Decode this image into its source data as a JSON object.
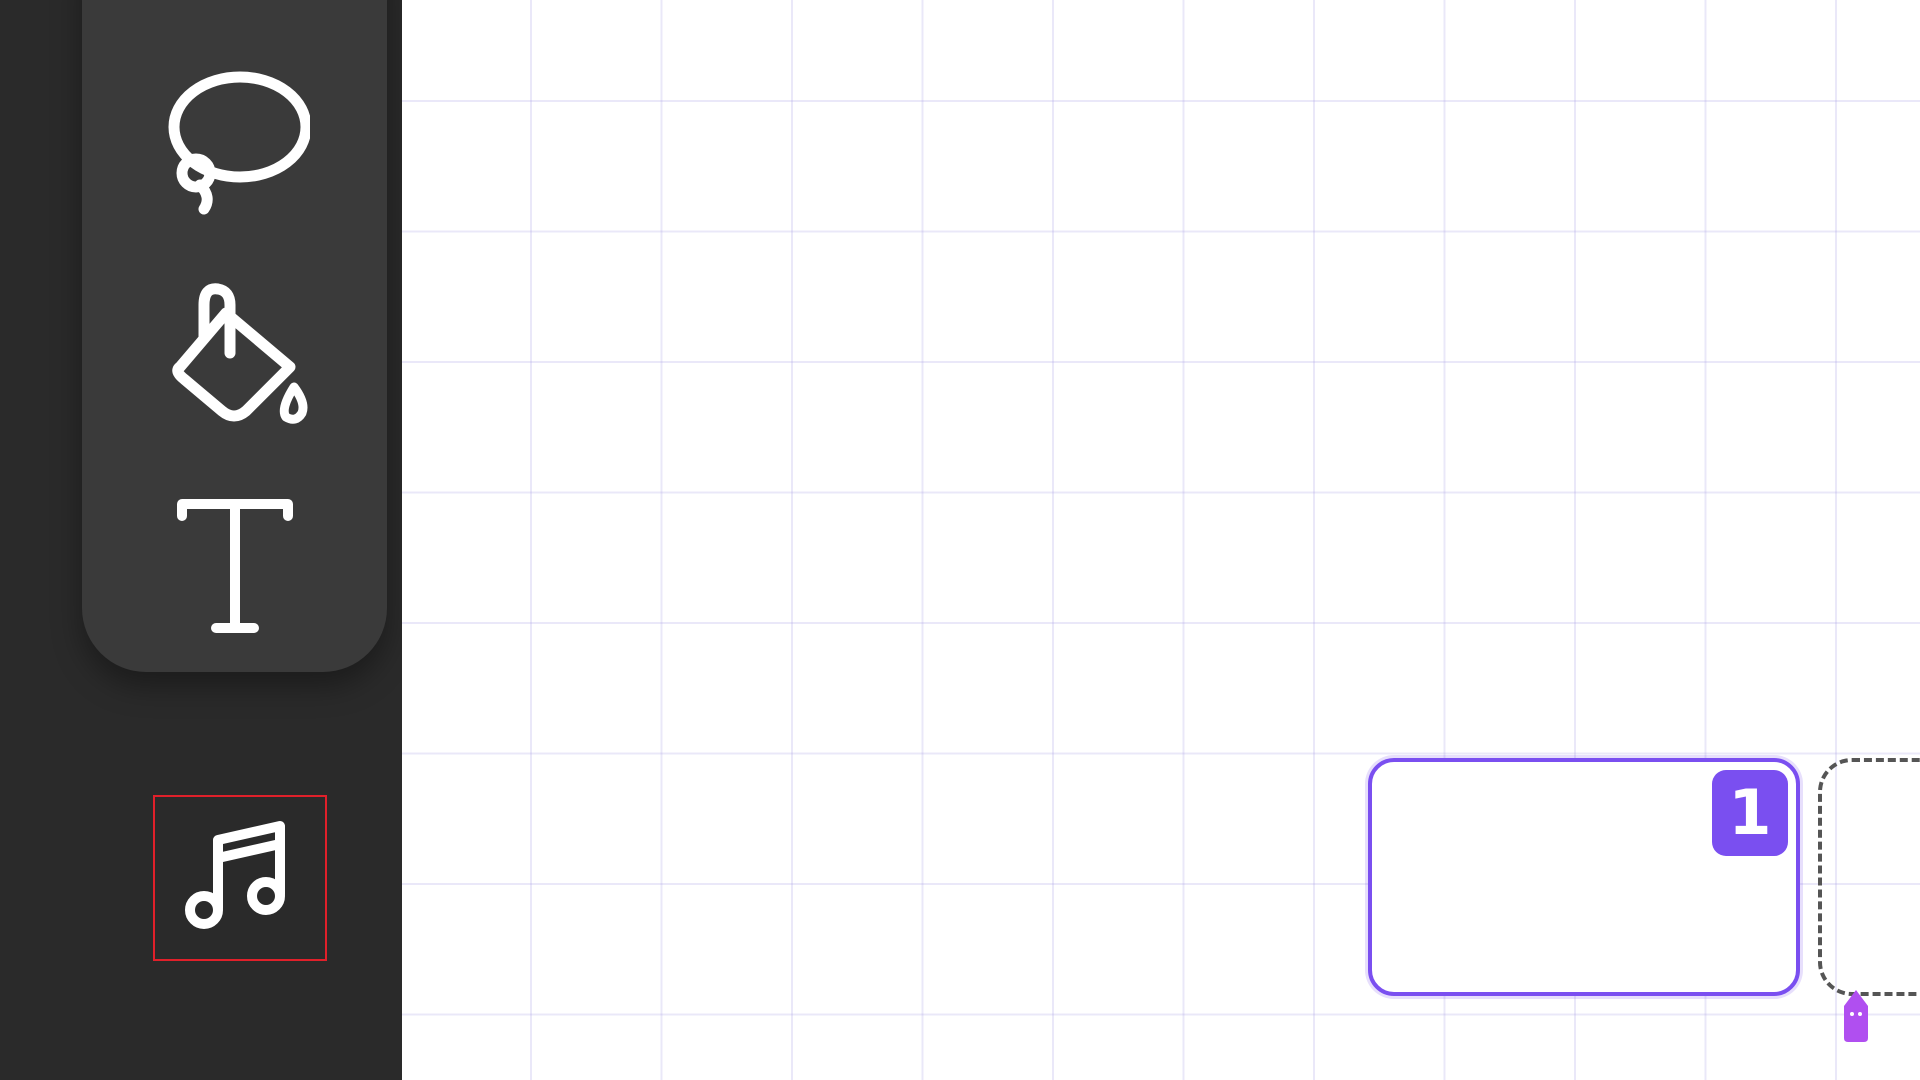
{
  "toolbar": {
    "tools": [
      {
        "id": "lasso",
        "icon": "lasso-icon"
      },
      {
        "id": "fill",
        "icon": "paint-bucket-icon"
      },
      {
        "id": "text",
        "icon": "text-icon"
      }
    ],
    "music_tool": {
      "icon": "music-note-icon",
      "highlight_color": "#e0202a"
    }
  },
  "canvas": {
    "grid_color": "#c8c2ee",
    "frames": [
      {
        "badge_label": "1",
        "accent_color": "#7a4ff0"
      }
    ]
  },
  "colors": {
    "sidebar_bg": "#2a2a2a",
    "panel_bg": "#3a3a3a",
    "accent": "#7a4ff0",
    "cursor": "#b04ff0"
  }
}
